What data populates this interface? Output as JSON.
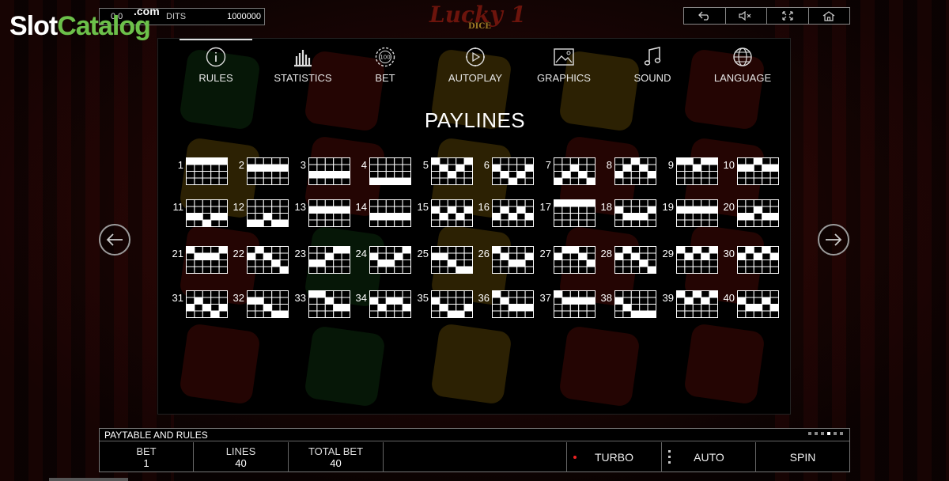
{
  "watermark": {
    "part1": "Slot",
    "part2": "Catalog",
    "part3": ".com"
  },
  "top_info": {
    "value_left": "0.0",
    "label": "DITS",
    "value_right": "1000000"
  },
  "game_logo": {
    "name": "Lucky 1",
    "sub": "DICE"
  },
  "top_buttons": [
    {
      "name": "back-button",
      "icon": "undo-arrow-icon"
    },
    {
      "name": "mute-button",
      "icon": "speaker-mute-icon"
    },
    {
      "name": "fullscreen-button",
      "icon": "fullscreen-icon"
    },
    {
      "name": "home-button",
      "icon": "home-icon"
    }
  ],
  "tabs": [
    {
      "label": "RULES",
      "icon": "info-icon",
      "active": true
    },
    {
      "label": "STATISTICS",
      "icon": "bar-chart-icon"
    },
    {
      "label": "BET",
      "icon": "chip-icon"
    },
    {
      "label": "AUTOPLAY",
      "icon": "autoplay-icon"
    },
    {
      "label": "GRAPHICS",
      "icon": "image-icon"
    },
    {
      "label": "SOUND",
      "icon": "music-note-icon"
    },
    {
      "label": "LANGUAGE",
      "icon": "globe-icon"
    }
  ],
  "title": "PAYLINES",
  "paylines": [
    {
      "n": "1",
      "rows": [
        0,
        0,
        0,
        0,
        0
      ]
    },
    {
      "n": "2",
      "rows": [
        1,
        1,
        1,
        1,
        1
      ]
    },
    {
      "n": "3",
      "rows": [
        2,
        2,
        2,
        2,
        2
      ]
    },
    {
      "n": "4",
      "rows": [
        3,
        3,
        3,
        3,
        3
      ]
    },
    {
      "n": "5",
      "rows": [
        0,
        1,
        2,
        1,
        0
      ]
    },
    {
      "n": "6",
      "rows": [
        1,
        2,
        3,
        2,
        1
      ]
    },
    {
      "n": "7",
      "rows": [
        3,
        2,
        1,
        2,
        3
      ]
    },
    {
      "n": "8",
      "rows": [
        2,
        1,
        0,
        1,
        2
      ]
    },
    {
      "n": "9",
      "rows": [
        0,
        0,
        1,
        0,
        0
      ]
    },
    {
      "n": "10",
      "rows": [
        1,
        1,
        0,
        1,
        1
      ]
    },
    {
      "n": "11",
      "rows": [
        2,
        2,
        3,
        2,
        2
      ]
    },
    {
      "n": "12",
      "rows": [
        3,
        3,
        2,
        3,
        3
      ]
    },
    {
      "n": "13",
      "rows": [
        1,
        1,
        1,
        1,
        1
      ]
    },
    {
      "n": "14",
      "rows": [
        2,
        2,
        2,
        2,
        2
      ]
    },
    {
      "n": "15",
      "rows": [
        1,
        2,
        1,
        2,
        1
      ]
    },
    {
      "n": "16",
      "rows": [
        2,
        1,
        2,
        1,
        2
      ]
    },
    {
      "n": "17",
      "rows": [
        0,
        0,
        0,
        0,
        0
      ]
    },
    {
      "n": "18",
      "rows": [
        1,
        2,
        2,
        2,
        1
      ]
    },
    {
      "n": "19",
      "rows": [
        1,
        1,
        1,
        1,
        1
      ]
    },
    {
      "n": "20",
      "rows": [
        2,
        2,
        1,
        2,
        2
      ]
    },
    {
      "n": "21",
      "rows": [
        0,
        1,
        1,
        1,
        0
      ]
    },
    {
      "n": "22",
      "rows": [
        1,
        0,
        1,
        2,
        3
      ]
    },
    {
      "n": "23",
      "rows": [
        2,
        2,
        1,
        0,
        0
      ]
    },
    {
      "n": "24",
      "rows": [
        1,
        2,
        2,
        1,
        0
      ]
    },
    {
      "n": "25",
      "rows": [
        1,
        1,
        2,
        3,
        3
      ]
    },
    {
      "n": "26",
      "rows": [
        0,
        1,
        2,
        2,
        1
      ]
    },
    {
      "n": "27",
      "rows": [
        1,
        0,
        0,
        1,
        2
      ]
    },
    {
      "n": "28",
      "rows": [
        1,
        0,
        1,
        2,
        3
      ]
    },
    {
      "n": "29",
      "rows": [
        0,
        1,
        0,
        1,
        0
      ]
    },
    {
      "n": "30",
      "rows": [
        1,
        0,
        1,
        0,
        1
      ]
    },
    {
      "n": "31",
      "rows": [
        2,
        1,
        2,
        3,
        2
      ]
    },
    {
      "n": "32",
      "rows": [
        1,
        1,
        2,
        3,
        3
      ]
    },
    {
      "n": "33",
      "rows": [
        0,
        0,
        1,
        2,
        2
      ]
    },
    {
      "n": "34",
      "rows": [
        1,
        2,
        1,
        1,
        2
      ]
    },
    {
      "n": "35",
      "rows": [
        1,
        2,
        3,
        3,
        2
      ]
    },
    {
      "n": "36",
      "rows": [
        0,
        1,
        2,
        2,
        2
      ]
    },
    {
      "n": "37",
      "rows": [
        0,
        1,
        1,
        1,
        1
      ]
    },
    {
      "n": "38",
      "rows": [
        1,
        2,
        3,
        3,
        3
      ]
    },
    {
      "n": "39",
      "rows": [
        0,
        1,
        0,
        1,
        0
      ]
    },
    {
      "n": "40",
      "rows": [
        1,
        2,
        2,
        1,
        2
      ]
    }
  ],
  "bottom_bar": {
    "heading": "PAYTABLE AND RULES",
    "bet_label": "BET",
    "bet_value": "1",
    "lines_label": "LINES",
    "lines_value": "40",
    "total_label": "TOTAL BET",
    "total_value": "40",
    "turbo": "TURBO",
    "auto": "AUTO",
    "spin": "SPIN"
  }
}
